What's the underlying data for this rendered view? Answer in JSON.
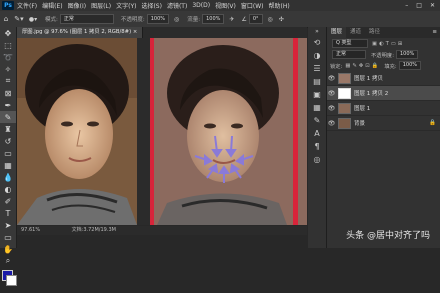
{
  "menu": {
    "logo": "Ps",
    "items": [
      "文件(F)",
      "编辑(E)",
      "图像(I)",
      "图层(L)",
      "文字(Y)",
      "选择(S)",
      "滤镜(T)",
      "3D(D)",
      "视图(V)",
      "窗口(W)",
      "帮助(H)"
    ],
    "window_controls": [
      "–",
      "□",
      "✕"
    ]
  },
  "options": {
    "mode_label": "模式:",
    "mode_value": "正常",
    "opacity_label": "不透明度:",
    "opacity_value": "100%",
    "flow_label": "流量:",
    "flow_value": "100%",
    "angle_value": "0°"
  },
  "tabs": [
    {
      "label": "厚图.jpg @ 97.6% (图层 1 拷贝 2, RGB/8#) ×",
      "active": true
    }
  ],
  "status": {
    "zoom": "97.61%",
    "doc": "文档:3.72M/19.3M"
  },
  "layers_panel": {
    "tabs": [
      "图层",
      "通道",
      "路径"
    ],
    "kind_label": "Q 类型",
    "blend_mode": "正常",
    "opacity_label": "不透明度:",
    "opacity_value": "100%",
    "lock_label": "锁定:",
    "fill_label": "填充:",
    "fill_value": "100%",
    "layers": [
      {
        "name": "图层 1 拷贝",
        "visible": true,
        "selected": false
      },
      {
        "name": "图层 1 拷贝 2",
        "visible": true,
        "selected": true
      },
      {
        "name": "图层 1",
        "visible": true,
        "selected": false
      },
      {
        "name": "背景",
        "visible": true,
        "selected": false
      }
    ]
  },
  "colors": {
    "foreground": "#1a1aa8",
    "background": "#ffffff",
    "accent_red": "#d8243a",
    "arrow_purple": "#8a7ad8"
  },
  "watermark": "头条 @居中对齐了吗"
}
